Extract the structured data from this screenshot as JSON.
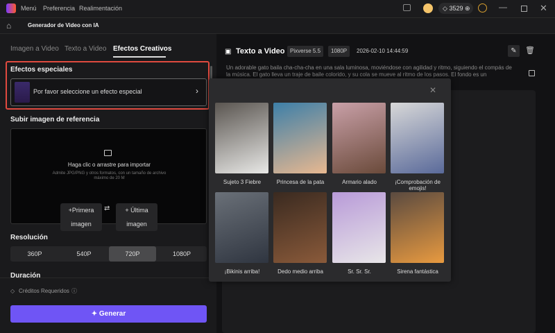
{
  "titlebar": {
    "menu": "Menú",
    "preference": "Preferencia",
    "feedback": "Realimentación",
    "credits": "3529"
  },
  "subbar": {
    "title": "Generador de Video con IA"
  },
  "tabs": [
    "Imagen a Video",
    "Texto a Video",
    "Efectos Creativos"
  ],
  "effects": {
    "title": "Efectos especiales",
    "placeholder": "Por favor seleccione un efecto especial"
  },
  "upload": {
    "title": "Subir imagen de referencia",
    "main": "Haga clic o arrastre para importar",
    "hint1": "Admite JPG/PNG y otros formatos, con un tamaño de archivo",
    "hint2": "máximo de 20 M",
    "first": "+Primera imagen",
    "last": "+ Última imagen"
  },
  "resolution": {
    "title": "Resolución",
    "options": [
      "360P",
      "540P",
      "720P",
      "1080P"
    ],
    "selected": "720P"
  },
  "duration": {
    "title": "Duración"
  },
  "credits_label": "Créditos Requeridos",
  "generate": "Generar",
  "task": {
    "title": "Texto a Video",
    "model": "Pixverse 5.5",
    "res": "1080P",
    "time": "2026-02-10 14:44:59",
    "prompt": "Un adorable gato baila cha-cha-cha en una sala luminosa, moviéndose con agilidad y ritmo, siguiendo el compás de la música. El gato lleva un traje de baile colorido, y su cola se mueve al ritmo de los pasos. El fondo es un"
  },
  "popup": {
    "items": [
      {
        "label": "Sujeto 3 Fiebre",
        "c1": "#5a5550",
        "c2": "#e8e8e6"
      },
      {
        "label": "Princesa de la pata",
        "c1": "#3d7fa8",
        "c2": "#e8b890"
      },
      {
        "label": "Armario alado",
        "c1": "#c9a0a8",
        "c2": "#6a4a3a"
      },
      {
        "label": "¡Comprobación de emojis!",
        "c1": "#d8d8d8",
        "c2": "#5a6a9a"
      },
      {
        "label": "¡Bikinis arriba!",
        "c1": "#6a7078",
        "c2": "#2f3540"
      },
      {
        "label": "Dedo medio arriba",
        "c1": "#3a2a20",
        "c2": "#8a5a3a"
      },
      {
        "label": "Sr. Sr. Sr.",
        "c1": "#b89ad8",
        "c2": "#e8e6e8"
      },
      {
        "label": "Sirena fantástica",
        "c1": "#5a4a40",
        "c2": "#e89a40"
      }
    ]
  }
}
